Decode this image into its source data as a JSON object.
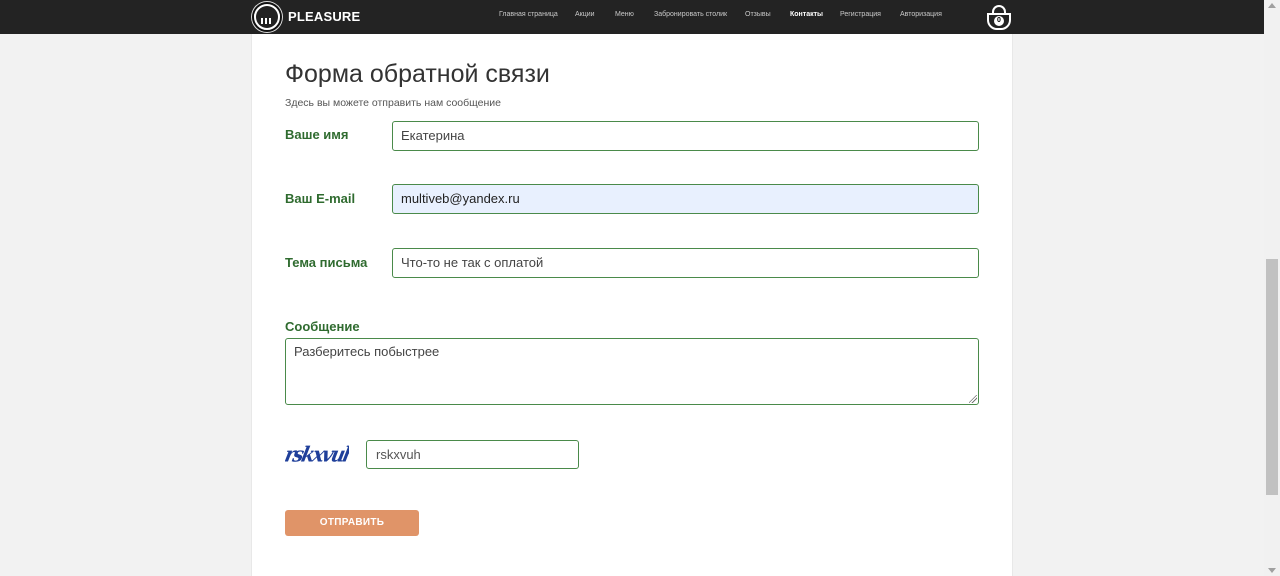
{
  "header": {
    "brand": "PLEASURE",
    "nav": [
      {
        "label": "Главная страница"
      },
      {
        "label": "Акции"
      },
      {
        "label": "Меню"
      },
      {
        "label": "Забронировать столик"
      },
      {
        "label": "Отзывы"
      },
      {
        "label": "Контакты",
        "active": true
      },
      {
        "label": "Регистрация"
      },
      {
        "label": "Авторизация"
      }
    ],
    "cart_count": "0"
  },
  "form": {
    "title": "Форма обратной связи",
    "subtitle": "Здесь вы можете отправить нам сообщение",
    "name": {
      "label": "Ваше имя",
      "value": "Екатерина"
    },
    "email": {
      "label": "Ваш E-mail",
      "value": "multiveb@yandex.ru"
    },
    "subject": {
      "label": "Тема письма",
      "value": "Что-то не так с оплатой"
    },
    "message": {
      "label": "Сообщение",
      "value": "Разберитесь побыстрее"
    },
    "captcha": {
      "image_text": "rskxvuh",
      "value": "rskxvuh"
    },
    "submit_label": "ОТПРАВИТЬ"
  },
  "colors": {
    "navbar": "#232323",
    "label_green": "#2f6b2f",
    "field_border": "#4a8a4a",
    "submit_bg": "#e09468",
    "autofill_bg": "#e8f0fe"
  }
}
